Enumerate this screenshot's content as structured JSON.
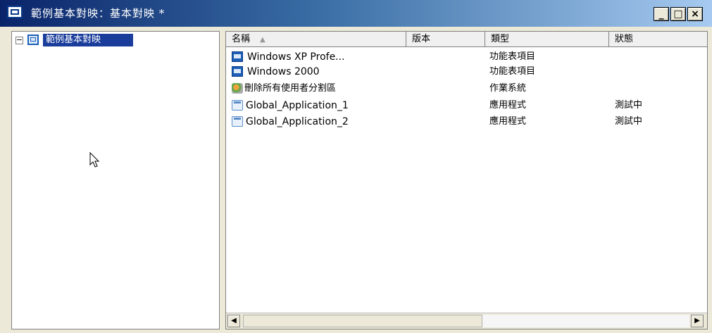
{
  "window": {
    "title": "範例基本對映：基本對映 *",
    "buttons": {
      "minimize": "_",
      "maximize": "□",
      "close": "×"
    },
    "title_gradient": [
      "#0a246a",
      "#a6caf0"
    ]
  },
  "tree": {
    "toggle": "−",
    "root_label": "範例基本對映",
    "selected_color": "#1a3d9c"
  },
  "list": {
    "columns": [
      "名稱",
      "版本",
      "類型",
      "狀態"
    ],
    "sort_indicator": "▲",
    "rows": [
      {
        "icon": "menu-item-icon",
        "name": "Windows XP Profe...",
        "version": "",
        "type": "功能表項目",
        "status": ""
      },
      {
        "icon": "menu-item-icon",
        "name": "Windows 2000",
        "version": "",
        "type": "功能表項目",
        "status": ""
      },
      {
        "icon": "os-icon",
        "name": "刪除所有使用者分割區",
        "version": "",
        "type": "作業系統",
        "status": ""
      },
      {
        "icon": "application-icon",
        "name": "Global_Application_1",
        "version": "",
        "type": "應用程式",
        "status": "測試中"
      },
      {
        "icon": "application-icon",
        "name": "Global_Application_2",
        "version": "",
        "type": "應用程式",
        "status": "測試中"
      }
    ]
  },
  "scrollbar": {
    "left_arrow": "◀",
    "right_arrow": "▶"
  }
}
